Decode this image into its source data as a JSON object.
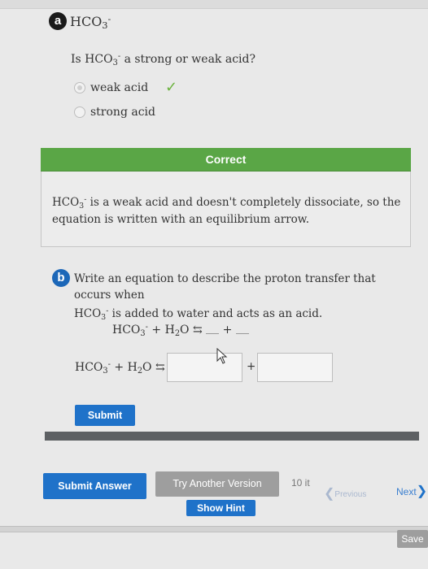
{
  "part_a": {
    "badge": "a",
    "species": "HCO",
    "species_sub": "3",
    "species_sup": "-",
    "question_prefix": "Is HCO",
    "question_sub": "3",
    "question_sup": "-",
    "question_suffix": " a strong or weak acid?",
    "options": [
      {
        "label": "weak acid",
        "selected": true,
        "correct": true
      },
      {
        "label": "strong acid",
        "selected": false,
        "correct": false
      }
    ],
    "feedback": {
      "header": "Correct",
      "text_prefix": "HCO",
      "text_sub": "3",
      "text_sup": "-",
      "text_suffix": " is a weak acid and doesn't completely dissociate, so the equation is written with an equilibrium arrow."
    }
  },
  "part_b": {
    "badge": "b",
    "prompt_line1": "Write an equation to describe the proton transfer that occurs when",
    "prompt_line2_prefix": "HCO",
    "prompt_line2_sub": "3",
    "prompt_line2_sup": "-",
    "prompt_line2_suffix": " is added to water and acts as an acid.",
    "template": {
      "reactant1": "HCO",
      "reactant1_sub": "3",
      "reactant1_sup": "-",
      "plus": " + ",
      "reactant2": "H",
      "reactant2_sub": "2",
      "reactant2_tail": "O",
      "arrow": "⇆",
      "plus2": "+"
    },
    "answer": {
      "reactant1": "HCO",
      "reactant1_sub": "3",
      "reactant1_sup": "-",
      "plus": " + ",
      "reactant2": "H",
      "reactant2_sub": "2",
      "reactant2_tail": "O",
      "arrow": "⇆",
      "plus2": "+",
      "box1_value": "",
      "box2_value": ""
    },
    "submit_label": "Submit"
  },
  "footer": {
    "submit_answer": "Submit Answer",
    "try_another": "Try Another Version",
    "show_hint": "Show Hint",
    "attempts": "10 it",
    "previous": "Previous",
    "next": "Next",
    "save": "Save"
  },
  "colors": {
    "correct_green": "#5aa646",
    "button_blue": "#1f72c9",
    "check_green": "#6cb33f"
  }
}
